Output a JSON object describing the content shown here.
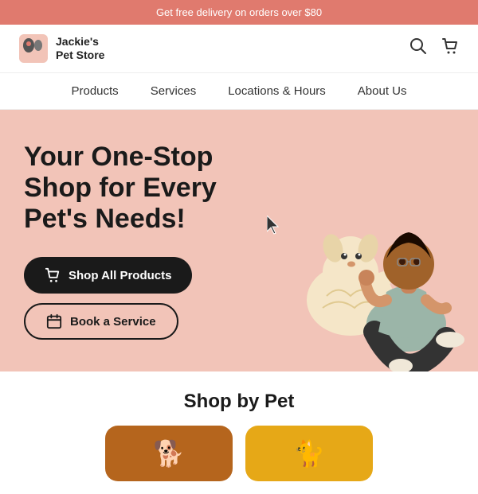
{
  "announcement": {
    "text": "Get free delivery on orders over $80"
  },
  "header": {
    "logo_line1": "Jackie's",
    "logo_line2": "Pet Store",
    "search_icon": "🔍",
    "cart_icon": "🛒"
  },
  "nav": {
    "items": [
      {
        "label": "Products",
        "id": "products"
      },
      {
        "label": "Services",
        "id": "services"
      },
      {
        "label": "Locations & Hours",
        "id": "locations"
      },
      {
        "label": "About Us",
        "id": "about"
      }
    ]
  },
  "hero": {
    "title": "Your One-Stop Shop for Every Pet's Needs!",
    "btn_primary_label": "Shop All Products",
    "btn_secondary_label": "Book a Service",
    "cart_icon": "🛒",
    "calendar_icon": "📅"
  },
  "shop_by_pet": {
    "title": "Shop by Pet"
  }
}
